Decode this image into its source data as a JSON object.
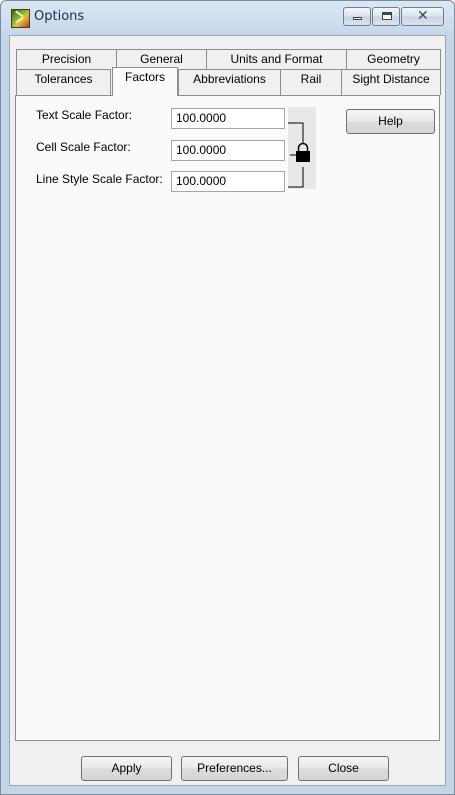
{
  "window": {
    "title": "Options"
  },
  "tabs_row1": [
    {
      "label": "Precision"
    },
    {
      "label": "General"
    },
    {
      "label": "Units and Format"
    },
    {
      "label": "Geometry"
    }
  ],
  "tabs_row2": [
    {
      "label": "Tolerances"
    },
    {
      "label": "Factors"
    },
    {
      "label": "Abbreviations"
    },
    {
      "label": "Rail"
    },
    {
      "label": "Sight Distance"
    }
  ],
  "active_tab": "Factors",
  "factors": {
    "text_scale": {
      "label": "Text Scale Factor:",
      "value": "100.0000"
    },
    "cell_scale": {
      "label": "Cell Scale Factor:",
      "value": "100.0000"
    },
    "line_style_scale": {
      "label": "Line Style Scale Factor:",
      "value": "100.0000"
    },
    "lock_state": "locked",
    "help_label": "Help"
  },
  "footer": {
    "apply_label": "Apply",
    "preferences_label": "Preferences...",
    "close_label": "Close"
  }
}
